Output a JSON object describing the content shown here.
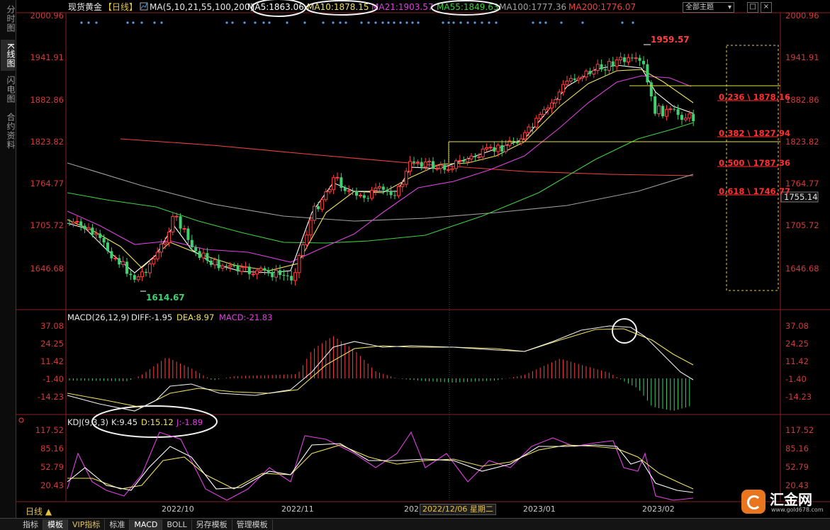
{
  "left_rail": [
    {
      "label": "分时图",
      "active": false
    },
    {
      "label": "K线图",
      "active": true
    },
    {
      "label": "闪电图",
      "active": false
    },
    {
      "label": "合约资料",
      "active": false
    }
  ],
  "header": {
    "symbol": "现货黄金",
    "period_tag": "【日线】",
    "ma_params": "MA(5,10,21,55,100,200)",
    "ma_values": [
      {
        "label": "MA5:1863.06",
        "color": "#ffffff"
      },
      {
        "label": "MA10:1878.15",
        "color": "#f0e060"
      },
      {
        "label": "MA21:1903.57",
        "color": "#e040e0"
      },
      {
        "label": "MA55:1849.63",
        "color": "#40d040"
      },
      {
        "label": "MA100:1777.36",
        "color": "#a0a0a0"
      },
      {
        "label": "MA200:1776.07",
        "color": "#f04040"
      }
    ],
    "theme_select": "全部主题",
    "window_buttons": [
      "□",
      "×"
    ]
  },
  "price_axis": {
    "ticks": [
      "2000.96",
      "1941.91",
      "1882.86",
      "1823.82",
      "1764.77",
      "1705.72",
      "1646.68"
    ],
    "current_price": "1755.14"
  },
  "annotations": {
    "high_label": "1959.57",
    "low_label": "1614.67",
    "fib_levels": [
      "0.236 \\ 1878.16",
      "0.382 \\ 1827.94",
      "0.500 \\ 1787.36",
      "0.618 \\ 1746.77"
    ]
  },
  "macd": {
    "title": "MACD(26,12,9)",
    "diff": "DIFF:-1.95",
    "dea": "DEA:8.97",
    "macd": "MACD:-21.83",
    "ticks": [
      "37.08",
      "24.25",
      "11.42",
      "-1.40",
      "-14.23"
    ]
  },
  "kdj": {
    "title": "KDJ(9,3,3)",
    "k": "K:9.45",
    "d": "D:15.12",
    "j": "J:-1.89",
    "ticks": [
      "117.52",
      "85.16",
      "52.79",
      "20.43"
    ]
  },
  "x_axis": {
    "period_label": "日线 ▲",
    "labels": [
      "2022/10",
      "2022/11",
      "202",
      "2023/01",
      "2023/02"
    ],
    "cursor_date": "2022/12/06 星期二"
  },
  "bottom_tabs": [
    {
      "label": "指标",
      "active": false
    },
    {
      "label": "模板",
      "active": true
    },
    {
      "label": "VIP指标",
      "active": false
    },
    {
      "label": "标准",
      "active": false
    },
    {
      "label": "MACD",
      "active": true
    },
    {
      "label": "BOLL",
      "active": false
    },
    {
      "label": "另存模板",
      "active": false
    },
    {
      "label": "管理模板",
      "active": false
    }
  ],
  "brand": {
    "name": "汇金网",
    "url": "www.gold678.com"
  },
  "colors": {
    "up": "#ff4040",
    "down": "#40d070",
    "axis_text": "#d23a3a",
    "fib_text": "#ff3030",
    "yellow_line": "#e6e040"
  }
}
